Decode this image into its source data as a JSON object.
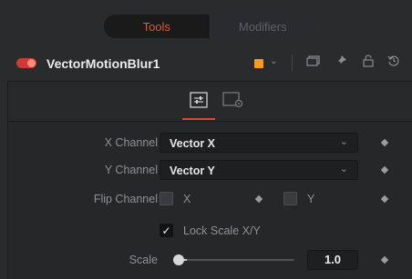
{
  "top_tabs": {
    "tools_label": "Tools",
    "modifiers_label": "Modifiers"
  },
  "node": {
    "name": "VectorMotionBlur1",
    "color": "#f59b1e"
  },
  "controls": {
    "x_channel": {
      "label": "X Channel",
      "value": "Vector X"
    },
    "y_channel": {
      "label": "Y Channel",
      "value": "Vector Y"
    },
    "flip_channel": {
      "label": "Flip Channel",
      "x_label": "X",
      "x_checked": false,
      "y_label": "Y",
      "y_checked": false
    },
    "lock_scale": {
      "label": "Lock Scale X/Y",
      "checked": true
    },
    "scale": {
      "label": "Scale",
      "value": "1.0"
    }
  },
  "colors": {
    "accent": "#e0492c",
    "toggle_on": "#cc3a36"
  }
}
